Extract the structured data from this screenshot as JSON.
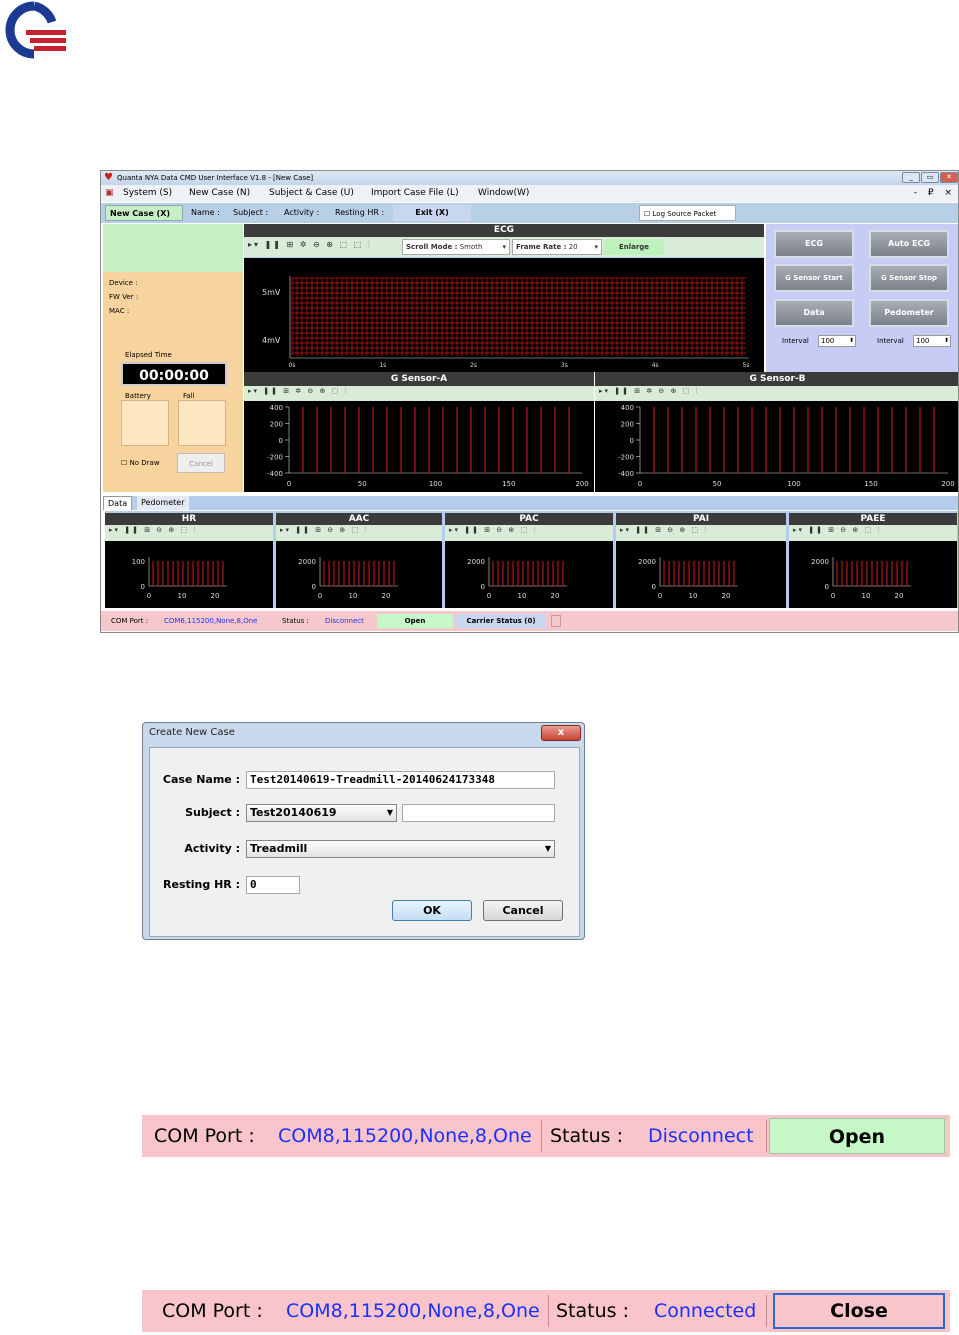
{
  "window": {
    "title": "Quanta NYA Data CMD User Interface V1.8 - [New Case]",
    "controls": [
      "_",
      "▭",
      "✕"
    ],
    "menu": [
      "System (S)",
      "New Case (N)",
      "Subject & Case (U)",
      "Import Case File (L)",
      "Window(W)"
    ],
    "mdi_controls": "- ₽ ×"
  },
  "casebar": {
    "new_case": "New Case (X)",
    "name": "Name :",
    "subject": "Subject :",
    "activity": "Activity :",
    "resting_hr": "Resting HR :",
    "exit": "Exit (X)",
    "log_source": "Log Source Packet"
  },
  "left_panel": {
    "device": "Device :",
    "fw_ver": "FW Ver :",
    "mac": "MAC :",
    "elapsed_label": "Elapsed Time",
    "elapsed_value": "00:00:00",
    "battery": "Battery",
    "fall": "Fall",
    "no_draw": "No Draw",
    "cancel": "Cancel"
  },
  "ecg": {
    "title": "ECG",
    "scroll_mode_label": "Scroll Mode :",
    "scroll_mode_value": "Smoth",
    "frame_rate_label": "Frame Rate :",
    "frame_rate_value": "20",
    "enlarge": "Enlarge",
    "y_ticks": [
      "5mV",
      "4mV"
    ],
    "x_ticks": [
      "0s",
      "1s",
      "2s",
      "3s",
      "4s",
      "5s"
    ]
  },
  "gsensor_a": {
    "title": "G Sensor-A",
    "y_ticks": [
      "400",
      "200",
      "0",
      "-200",
      "-400"
    ],
    "x_ticks": [
      "0",
      "50",
      "100",
      "150",
      "200"
    ]
  },
  "gsensor_b": {
    "title": "G Sensor-B",
    "y_ticks": [
      "400",
      "200",
      "0",
      "-200",
      "-400"
    ],
    "x_ticks": [
      "0",
      "50",
      "100",
      "150",
      "200"
    ]
  },
  "right_panel": {
    "ecg": "ECG",
    "auto_ecg": "Auto ECG",
    "g_start": "G Sensor Start",
    "g_stop": "G Sensor Stop",
    "data": "Data",
    "pedometer": "Pedometer",
    "interval_label": "Interval",
    "interval_1": "100",
    "interval_2": "100"
  },
  "tabs": [
    "Data",
    "Pedometer"
  ],
  "mini_charts": [
    {
      "title": "HR",
      "y_ticks": [
        "100",
        "0"
      ],
      "x_ticks": [
        "0",
        "10",
        "20"
      ]
    },
    {
      "title": "AAC",
      "y_ticks": [
        "2000",
        "0"
      ],
      "x_ticks": [
        "0",
        "10",
        "20"
      ]
    },
    {
      "title": "PAC",
      "y_ticks": [
        "2000",
        "0"
      ],
      "x_ticks": [
        "0",
        "10",
        "20"
      ]
    },
    {
      "title": "PAI",
      "y_ticks": [
        "2000",
        "0"
      ],
      "x_ticks": [
        "0",
        "10",
        "20"
      ]
    },
    {
      "title": "PAEE",
      "y_ticks": [
        "2000",
        "0"
      ],
      "x_ticks": [
        "0",
        "10",
        "20"
      ]
    }
  ],
  "window_status": {
    "com_label": "COM Port :",
    "com_value": "COM6,115200,None,8,One",
    "status_label": "Status :",
    "status_value": "Disconnect",
    "open": "Open",
    "carrier": "Carrier Status (0)"
  },
  "dialog": {
    "title": "Create New Case",
    "close": "x",
    "case_name_label": "Case Name :",
    "case_name_value": "Test20140619-Treadmill-20140624173348",
    "subject_label": "Subject :",
    "subject_value": "Test20140619",
    "activity_label": "Activity :",
    "activity_value": "Treadmill",
    "resting_hr_label": "Resting HR :",
    "resting_hr_value": "0",
    "ok": "OK",
    "cancel": "Cancel"
  },
  "strip_disconnected": {
    "com_label": "COM Port :",
    "com_value": "COM8,115200,None,8,One",
    "status_label": "Status :",
    "status_value": "Disconnect",
    "button": "Open"
  },
  "strip_connected": {
    "com_label": "COM Port :",
    "com_value": "COM8,115200,None,8,One",
    "status_label": "Status :",
    "status_value": "Connected",
    "button": "Close"
  },
  "colors": {
    "status_strip": "#f9c5cb",
    "link_blue": "#1b2fff",
    "open_green": "#c6f7c6",
    "close_border": "#2c66d6",
    "plot_red": "#d01818"
  }
}
